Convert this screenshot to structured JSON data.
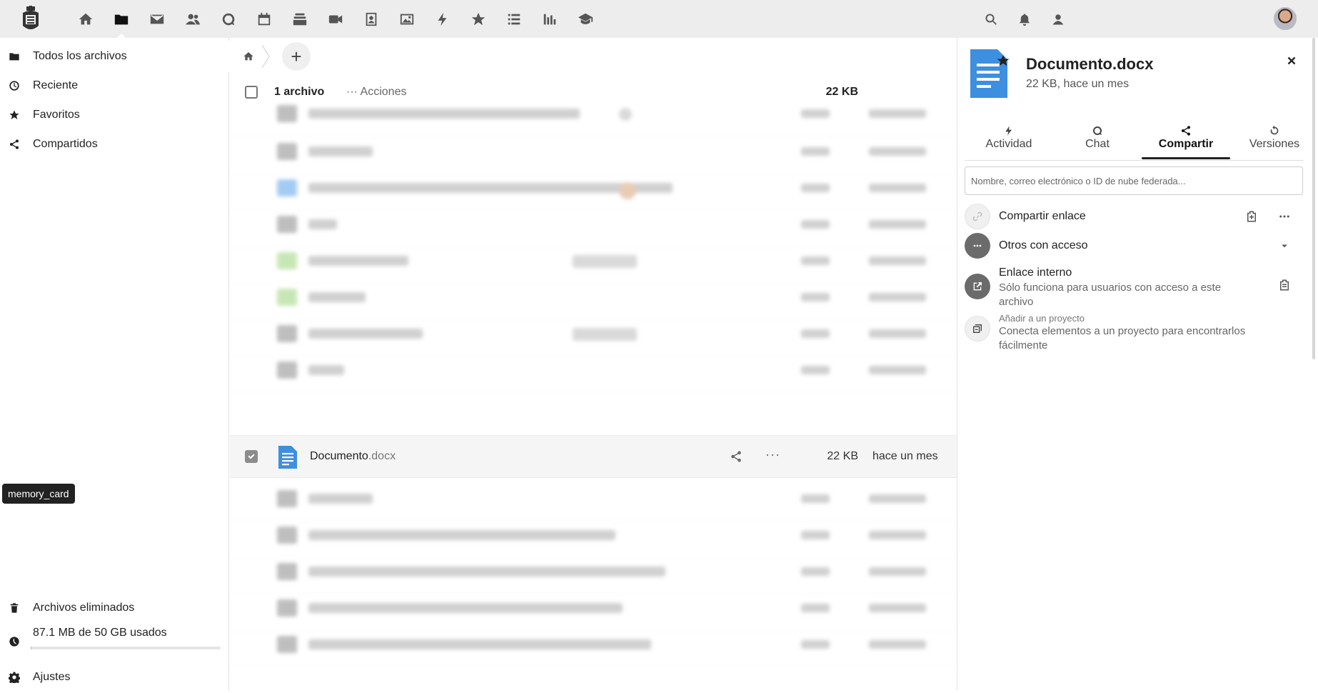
{
  "header": {
    "apps": [
      {
        "name": "home-icon",
        "label": "Inicio"
      },
      {
        "name": "folder-icon",
        "label": "Archivos"
      },
      {
        "name": "mail-icon",
        "label": "Correo"
      },
      {
        "name": "contacts-icon",
        "label": "Contactos"
      },
      {
        "name": "chat-icon",
        "label": "Conversaciones"
      },
      {
        "name": "calendar-icon",
        "label": "Calendario"
      },
      {
        "name": "deck-icon",
        "label": "Deck"
      },
      {
        "name": "video-icon",
        "label": "Video"
      },
      {
        "name": "contact-card-icon",
        "label": "Tarjetas"
      },
      {
        "name": "image-icon",
        "label": "Fotos"
      },
      {
        "name": "activity-icon",
        "label": "Actividad"
      },
      {
        "name": "star-icon",
        "label": "Favoritos"
      },
      {
        "name": "tasks-icon",
        "label": "Tareas"
      },
      {
        "name": "analytics-icon",
        "label": "Análisis"
      },
      {
        "name": "education-icon",
        "label": "Educación"
      }
    ],
    "active_app": "folder-icon"
  },
  "sidebar": {
    "items": [
      {
        "label": "Todos los archivos",
        "icon": "folder-icon"
      },
      {
        "label": "Reciente",
        "icon": "clock-icon"
      },
      {
        "label": "Favoritos",
        "icon": "star-icon"
      },
      {
        "label": "Compartidos",
        "icon": "share-icon"
      }
    ],
    "tooltip": "memory_card",
    "trash_label": "Archivos eliminados",
    "quota_label": "87.1 MB de 50 GB usados",
    "quota_fraction": 0.0017,
    "settings_label": "Ajustes"
  },
  "filelist": {
    "header": {
      "count_label": "1 archivo",
      "actions_label": "Acciones",
      "total_size": "22 KB"
    },
    "selected_file": {
      "name": "Documento",
      "extension": ".docx",
      "size": "22 KB",
      "modified": "hace un mes"
    }
  },
  "details": {
    "title": "Documento.docx",
    "subtitle": "22 KB, hace un mes",
    "tabs": [
      {
        "label": "Actividad",
        "icon": "activity-icon"
      },
      {
        "label": "Chat",
        "icon": "chat-icon"
      },
      {
        "label": "Compartir",
        "icon": "share-icon"
      },
      {
        "label": "Versiones",
        "icon": "history-icon"
      }
    ],
    "active_tab": "Compartir",
    "share_placeholder": "Nombre, correo electrónico o ID de nube federada...",
    "share_link_label": "Compartir enlace",
    "others_access_label": "Otros con acceso",
    "internal_link_title": "Enlace interno",
    "internal_link_desc": "Sólo funciona para usuarios con acceso a este archivo",
    "project_title": "Añadir a un proyecto",
    "project_desc": "Conecta elementos a un proyecto para encontrarlos fácilmente"
  },
  "colors": {
    "accent": "#222222",
    "doc_blue": "#3d8fe0",
    "header_bg": "#ededed"
  }
}
